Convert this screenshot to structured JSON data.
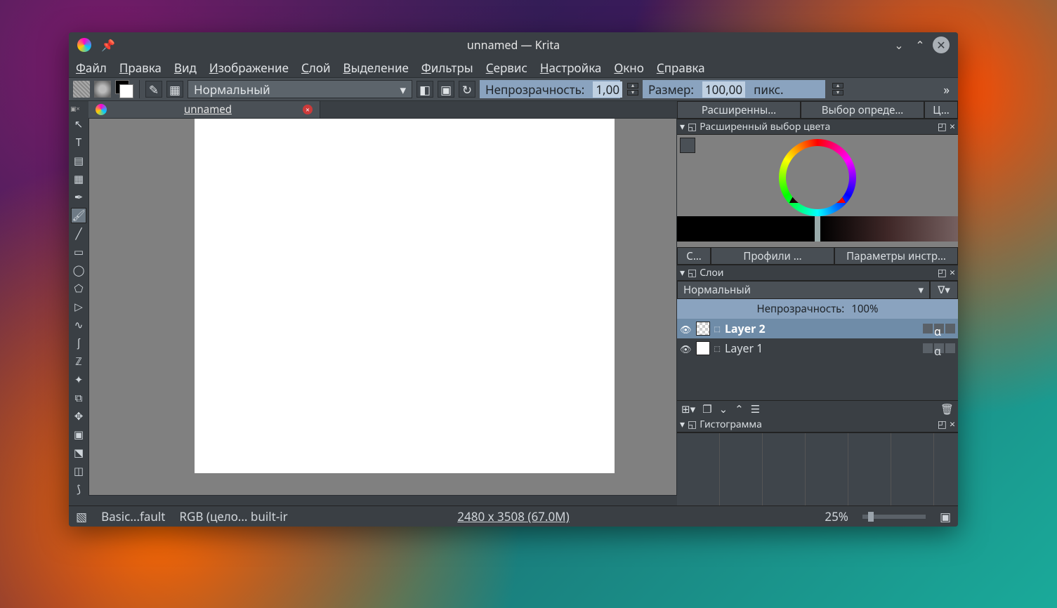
{
  "title": "unnamed  — Krita",
  "menu": [
    "Файл",
    "Правка",
    "Вид",
    "Изображение",
    "Слой",
    "Выделение",
    "Фильтры",
    "Сервис",
    "Настройка",
    "Окно",
    "Справка"
  ],
  "toolbar": {
    "blend_mode": "Нормальный",
    "opacity_label": "Непрозрачность:",
    "opacity_value": "1,00",
    "size_label": "Размер:",
    "size_value": "100,00",
    "size_unit": "пикс.",
    "more": "»"
  },
  "document": {
    "tab_name": "unnamed"
  },
  "tools": [
    "cursor",
    "text",
    "gradient",
    "pattern",
    "picker",
    "brush",
    "line",
    "rect",
    "ellipse",
    "polyline",
    "polygon",
    "bezier",
    "freehand",
    "calligraphy",
    "edit-shape",
    "crop",
    "move",
    "fill",
    "assist",
    "measure"
  ],
  "active_tool_index": 5,
  "right": {
    "top_tabs": [
      "Расширенны…",
      "Выбор опреде…",
      "Ц…"
    ],
    "color_title": "Расширенный выбор цвета",
    "mid_tabs": [
      "С…",
      "Профили …",
      "Параметры инстр…"
    ],
    "layers_title": "Слои",
    "layer_blend": "Нормальный",
    "layer_opacity_label": "Непрозрачность:",
    "layer_opacity_value": "100%",
    "layers": [
      {
        "name": "Layer 2",
        "selected": true,
        "checker": true
      },
      {
        "name": "Layer 1",
        "selected": false,
        "checker": false
      }
    ],
    "histogram_title": "Гистограмма"
  },
  "status": {
    "brush": "Basic...fault",
    "profile": "RGB (цело... built-ir",
    "dims": "2480 x 3508 (67.0M)",
    "zoom": "25%"
  }
}
